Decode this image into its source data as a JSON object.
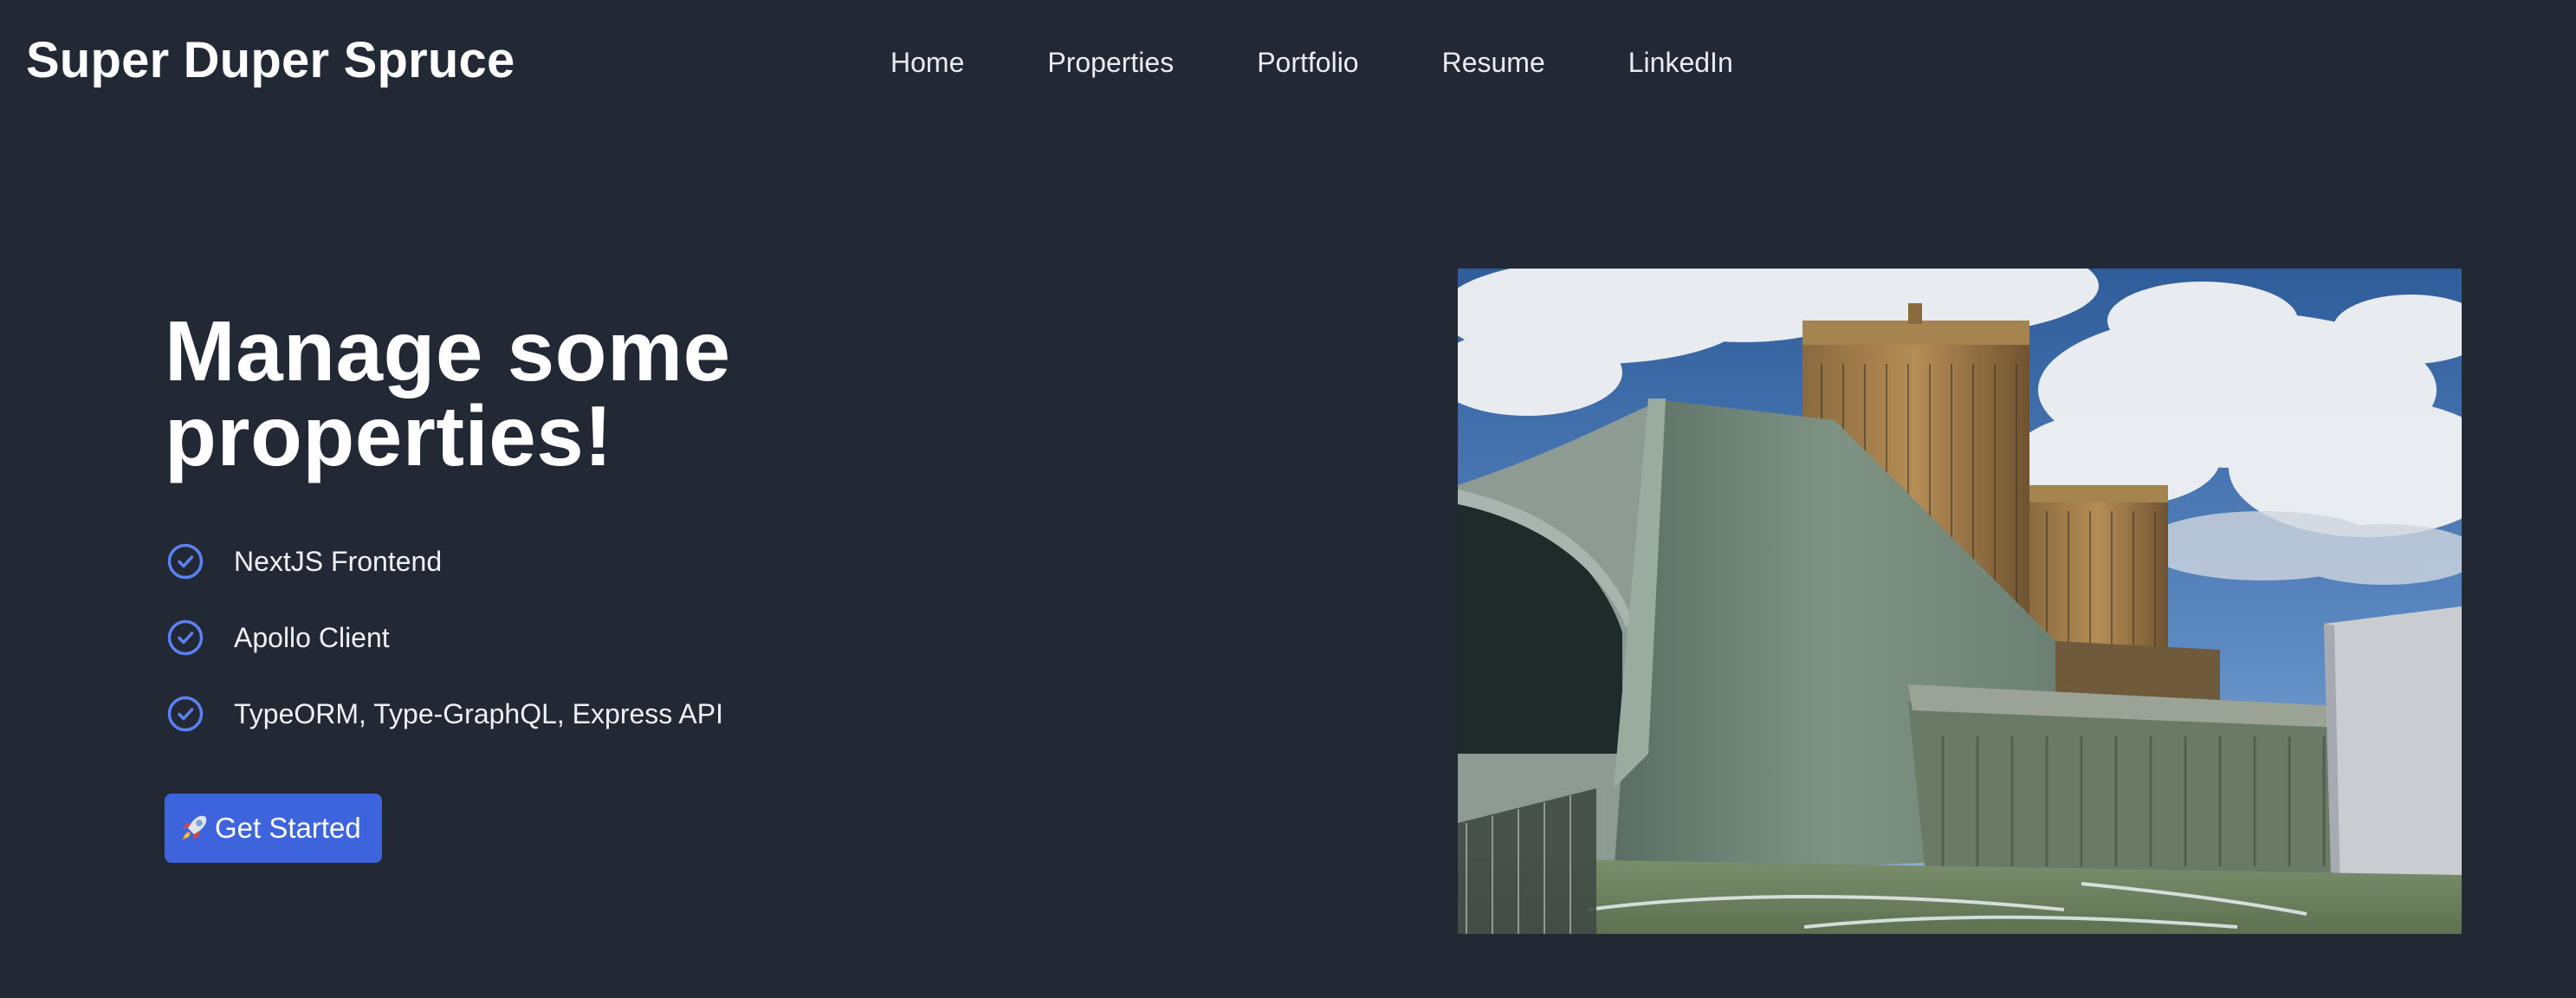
{
  "navbar": {
    "brand": "Super Duper Spruce",
    "links": [
      {
        "label": "Home"
      },
      {
        "label": "Properties"
      },
      {
        "label": "Portfolio"
      },
      {
        "label": "Resume"
      },
      {
        "label": "LinkedIn"
      }
    ]
  },
  "hero": {
    "headline_line1": "Manage some",
    "headline_line2": "properties!",
    "features": [
      {
        "label": "NextJS Frontend",
        "icon": "check-circle-icon"
      },
      {
        "label": "Apollo Client",
        "icon": "check-circle-icon"
      },
      {
        "label": "TypeORM, Type-GraphQL, Express API",
        "icon": "check-circle-icon"
      }
    ],
    "cta": {
      "label": "Get Started",
      "icon": "rocket-icon"
    },
    "image": {
      "description_icon": "building-photo"
    }
  },
  "colors": {
    "background": "#222834",
    "accent": "#3d63dd",
    "check": "#5b82f0",
    "text": "#ffffff"
  }
}
